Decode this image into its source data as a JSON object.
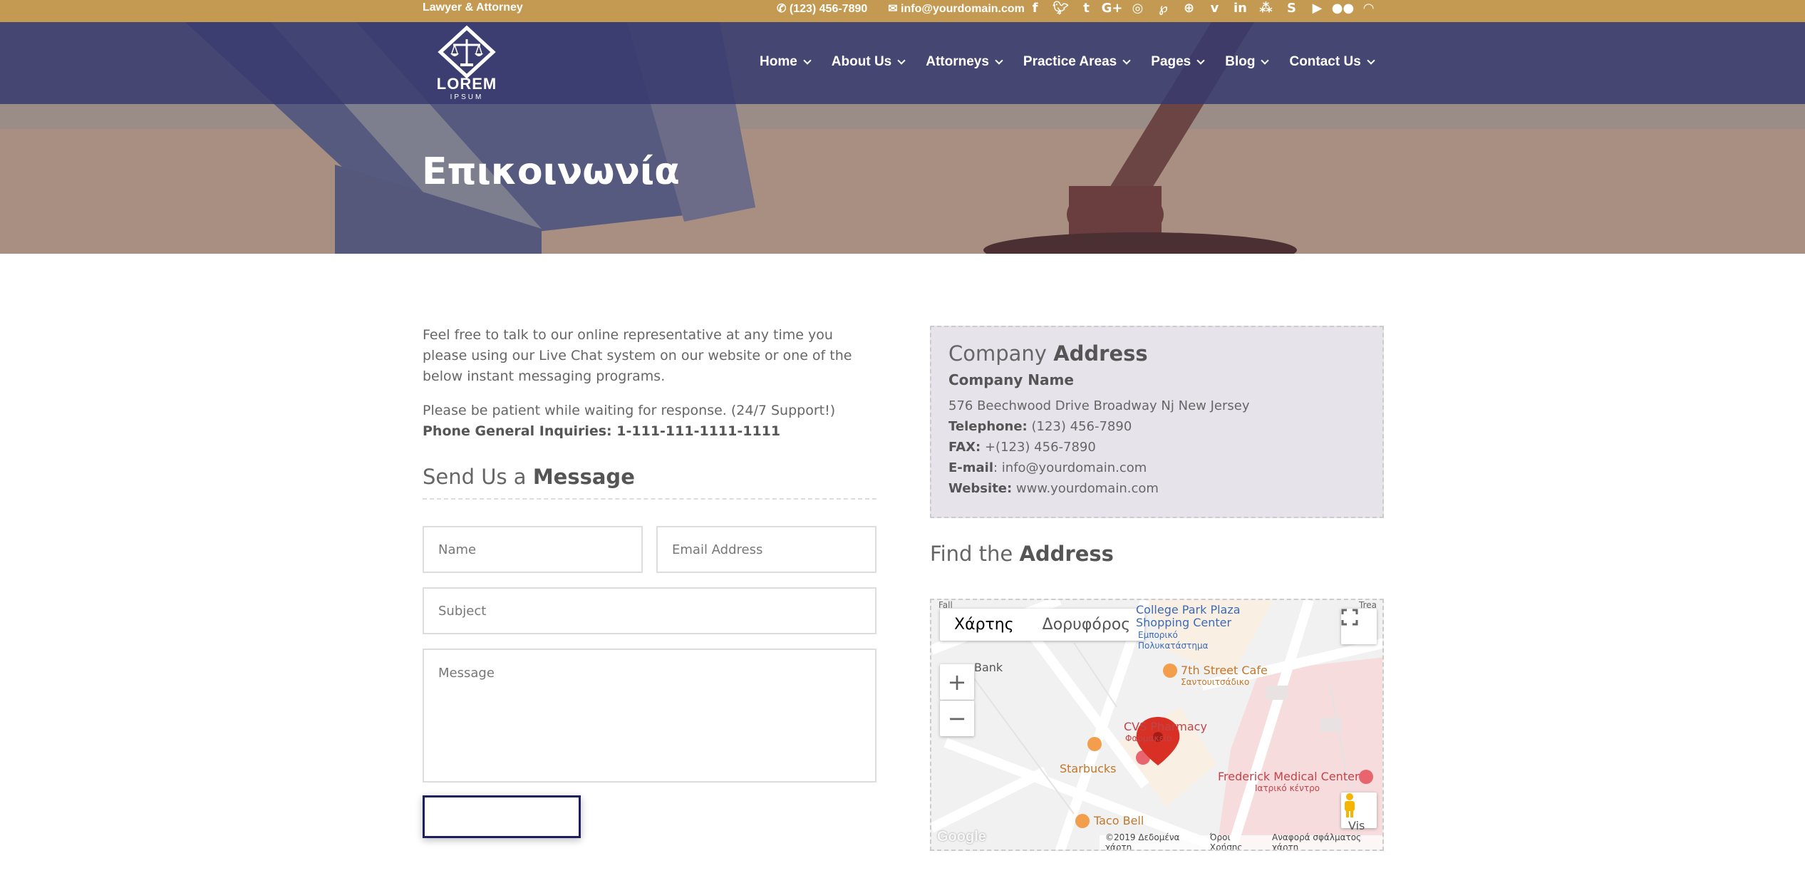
{
  "topbar": {
    "tagline": "Lawyer & Attorney",
    "phone": "(123) 456-7890",
    "email": "info@yourdomain.com",
    "phone_icon": "phone-icon",
    "email_icon": "envelope-icon",
    "social_icons": [
      "facebook-icon",
      "twitter-icon",
      "tumblr-icon",
      "google-plus-icon",
      "instagram-icon",
      "pinterest-icon",
      "dribbble-icon",
      "vimeo-icon",
      "linkedin-icon",
      "myspace-icon",
      "skype-icon",
      "youtube-icon",
      "flickr-icon",
      "rss-icon"
    ]
  },
  "header": {
    "logo_text": "LOREM",
    "logo_sub": "IPSUM",
    "nav": [
      {
        "label": "Home"
      },
      {
        "label": "About Us"
      },
      {
        "label": "Attorneys"
      },
      {
        "label": "Practice Areas"
      },
      {
        "label": "Pages"
      },
      {
        "label": "Blog"
      },
      {
        "label": "Contact Us"
      }
    ]
  },
  "hero": {
    "title": "Επικοινωνία"
  },
  "intro": {
    "paragraph1": "Feel free to talk to our online representative at any time you please using our Live Chat system on our website or one of the below instant messaging programs.",
    "paragraph2_text": "Please be patient while waiting for response. (24/7 Support!) ",
    "paragraph2_bold": "Phone General Inquiries: 1-111-111-1111-1111"
  },
  "form": {
    "heading_light": "Send Us a ",
    "heading_bold": "Message",
    "name_placeholder": "Name",
    "email_placeholder": "Email Address",
    "subject_placeholder": "Subject",
    "message_placeholder": "Message",
    "submit_label": ""
  },
  "company": {
    "heading_light": "Company ",
    "heading_bold": "Address",
    "name": "Company Name",
    "address": "576 Beechwood Drive Broadway Nj New Jersey",
    "telephone_label": "Telephone:",
    "telephone": " (123) 456-7890",
    "fax_label": "FAX:",
    "fax": " +(123) 456-7890",
    "email_label": "E-mail",
    "email": ": info@yourdomain.com",
    "website_label": "Website:",
    "website": " www.yourdomain.com"
  },
  "find": {
    "heading_light": "Find the ",
    "heading_bold": "Address"
  },
  "map": {
    "type_map": "Χάρτης",
    "type_satellite": "Δορυφόρος",
    "zoom_in": "+",
    "zoom_out": "−",
    "labels": {
      "college_park": "College Park Plaza",
      "shopping_center": "Shopping Center",
      "emporiko": "Εμπορικό",
      "polykatastima": "Πολυκατάστημα",
      "seventh_street": "7th Street Cafe",
      "santouitsadiko": "Σαντουιτσάδικο",
      "bank": "Bank",
      "cvs": "CVS Pharmacy",
      "farmakeio": "Φαρμακείο",
      "starbucks": "Starbucks",
      "frederick": "Frederick Medical Center",
      "iatriko": "Ιατρικό κέντρο",
      "taco_bell": "Taco Bell",
      "vis": "Vis",
      "fall": "Fall",
      "trea": "Trea"
    },
    "footer": {
      "data": "©2019 Δεδομένα χάρτη",
      "terms": "Όροι Χρήσης",
      "report": "Αναφορά σφάλματος χάρτη"
    },
    "google": "Google",
    "marker_color": "#d93025"
  },
  "colors": {
    "topbar": "#c49a52",
    "nav_band": "#37396e",
    "submit_border": "#1e1e5f"
  }
}
